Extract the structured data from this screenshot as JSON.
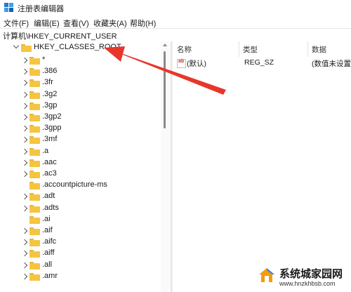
{
  "window": {
    "title": "注册表编辑器",
    "icon": "registry-icon"
  },
  "menu": [
    "文件(F)",
    "编辑(E)",
    "查看(V)",
    "收藏夹(A)",
    "帮助(H)"
  ],
  "address": "计算机\\HKEY_CURRENT_USER",
  "tree": {
    "root_label": "HKEY_CLASSES_ROOT",
    "items": [
      {
        "label": "*",
        "expandable": true
      },
      {
        "label": ".386",
        "expandable": true
      },
      {
        "label": ".3fr",
        "expandable": true
      },
      {
        "label": ".3g2",
        "expandable": true
      },
      {
        "label": ".3gp",
        "expandable": true
      },
      {
        "label": ".3gp2",
        "expandable": true
      },
      {
        "label": ".3gpp",
        "expandable": true
      },
      {
        "label": ".3mf",
        "expandable": true
      },
      {
        "label": ".a",
        "expandable": true
      },
      {
        "label": ".aac",
        "expandable": true
      },
      {
        "label": ".ac3",
        "expandable": true
      },
      {
        "label": ".accountpicture-ms",
        "expandable": false
      },
      {
        "label": ".adt",
        "expandable": true
      },
      {
        "label": ".adts",
        "expandable": true
      },
      {
        "label": ".ai",
        "expandable": false
      },
      {
        "label": ".aif",
        "expandable": true
      },
      {
        "label": ".aifc",
        "expandable": true
      },
      {
        "label": ".aiff",
        "expandable": true
      },
      {
        "label": ".all",
        "expandable": true
      },
      {
        "label": ".amr",
        "expandable": true
      }
    ]
  },
  "values_pane": {
    "headers": {
      "name": "名称",
      "type": "类型",
      "data": "数据"
    },
    "rows": [
      {
        "name": "(默认)",
        "type": "REG_SZ",
        "data": "(数值未设置)",
        "icon": "string-value-icon"
      }
    ]
  },
  "annotation": {
    "color": "#e8362b"
  },
  "watermark": {
    "title": "系统城",
    "title_suffix": "家园网",
    "url": "www.hnzkhbsb.com",
    "icon": "house-logo"
  },
  "colors": {
    "folder": "#f5c542",
    "folder_tab": "#e9b42f",
    "accent": "#0078d4"
  }
}
